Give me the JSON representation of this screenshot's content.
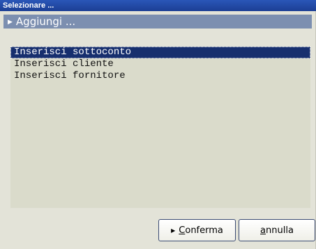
{
  "window": {
    "title": "Selezionare ..."
  },
  "section": {
    "title": "Aggiungi ..."
  },
  "list": {
    "items": [
      {
        "label": "Inserisci sottoconto",
        "selected": true
      },
      {
        "label": "Inserisci cliente",
        "selected": false
      },
      {
        "label": "Inserisci fornitore",
        "selected": false
      }
    ]
  },
  "buttons": {
    "confirm": {
      "accel": "C",
      "rest": "onferma"
    },
    "cancel": {
      "accel": "a",
      "rest": "nnulla"
    }
  },
  "colors": {
    "titlebar": "#1c3f94",
    "section_header": "#7c8fb0",
    "list_selection": "#172f6e",
    "list_background": "#dadbcb",
    "window_background": "#e3e3d8"
  },
  "icons": {
    "section_header": "triangle-right-icon",
    "confirm_button": "triangle-right-icon"
  }
}
